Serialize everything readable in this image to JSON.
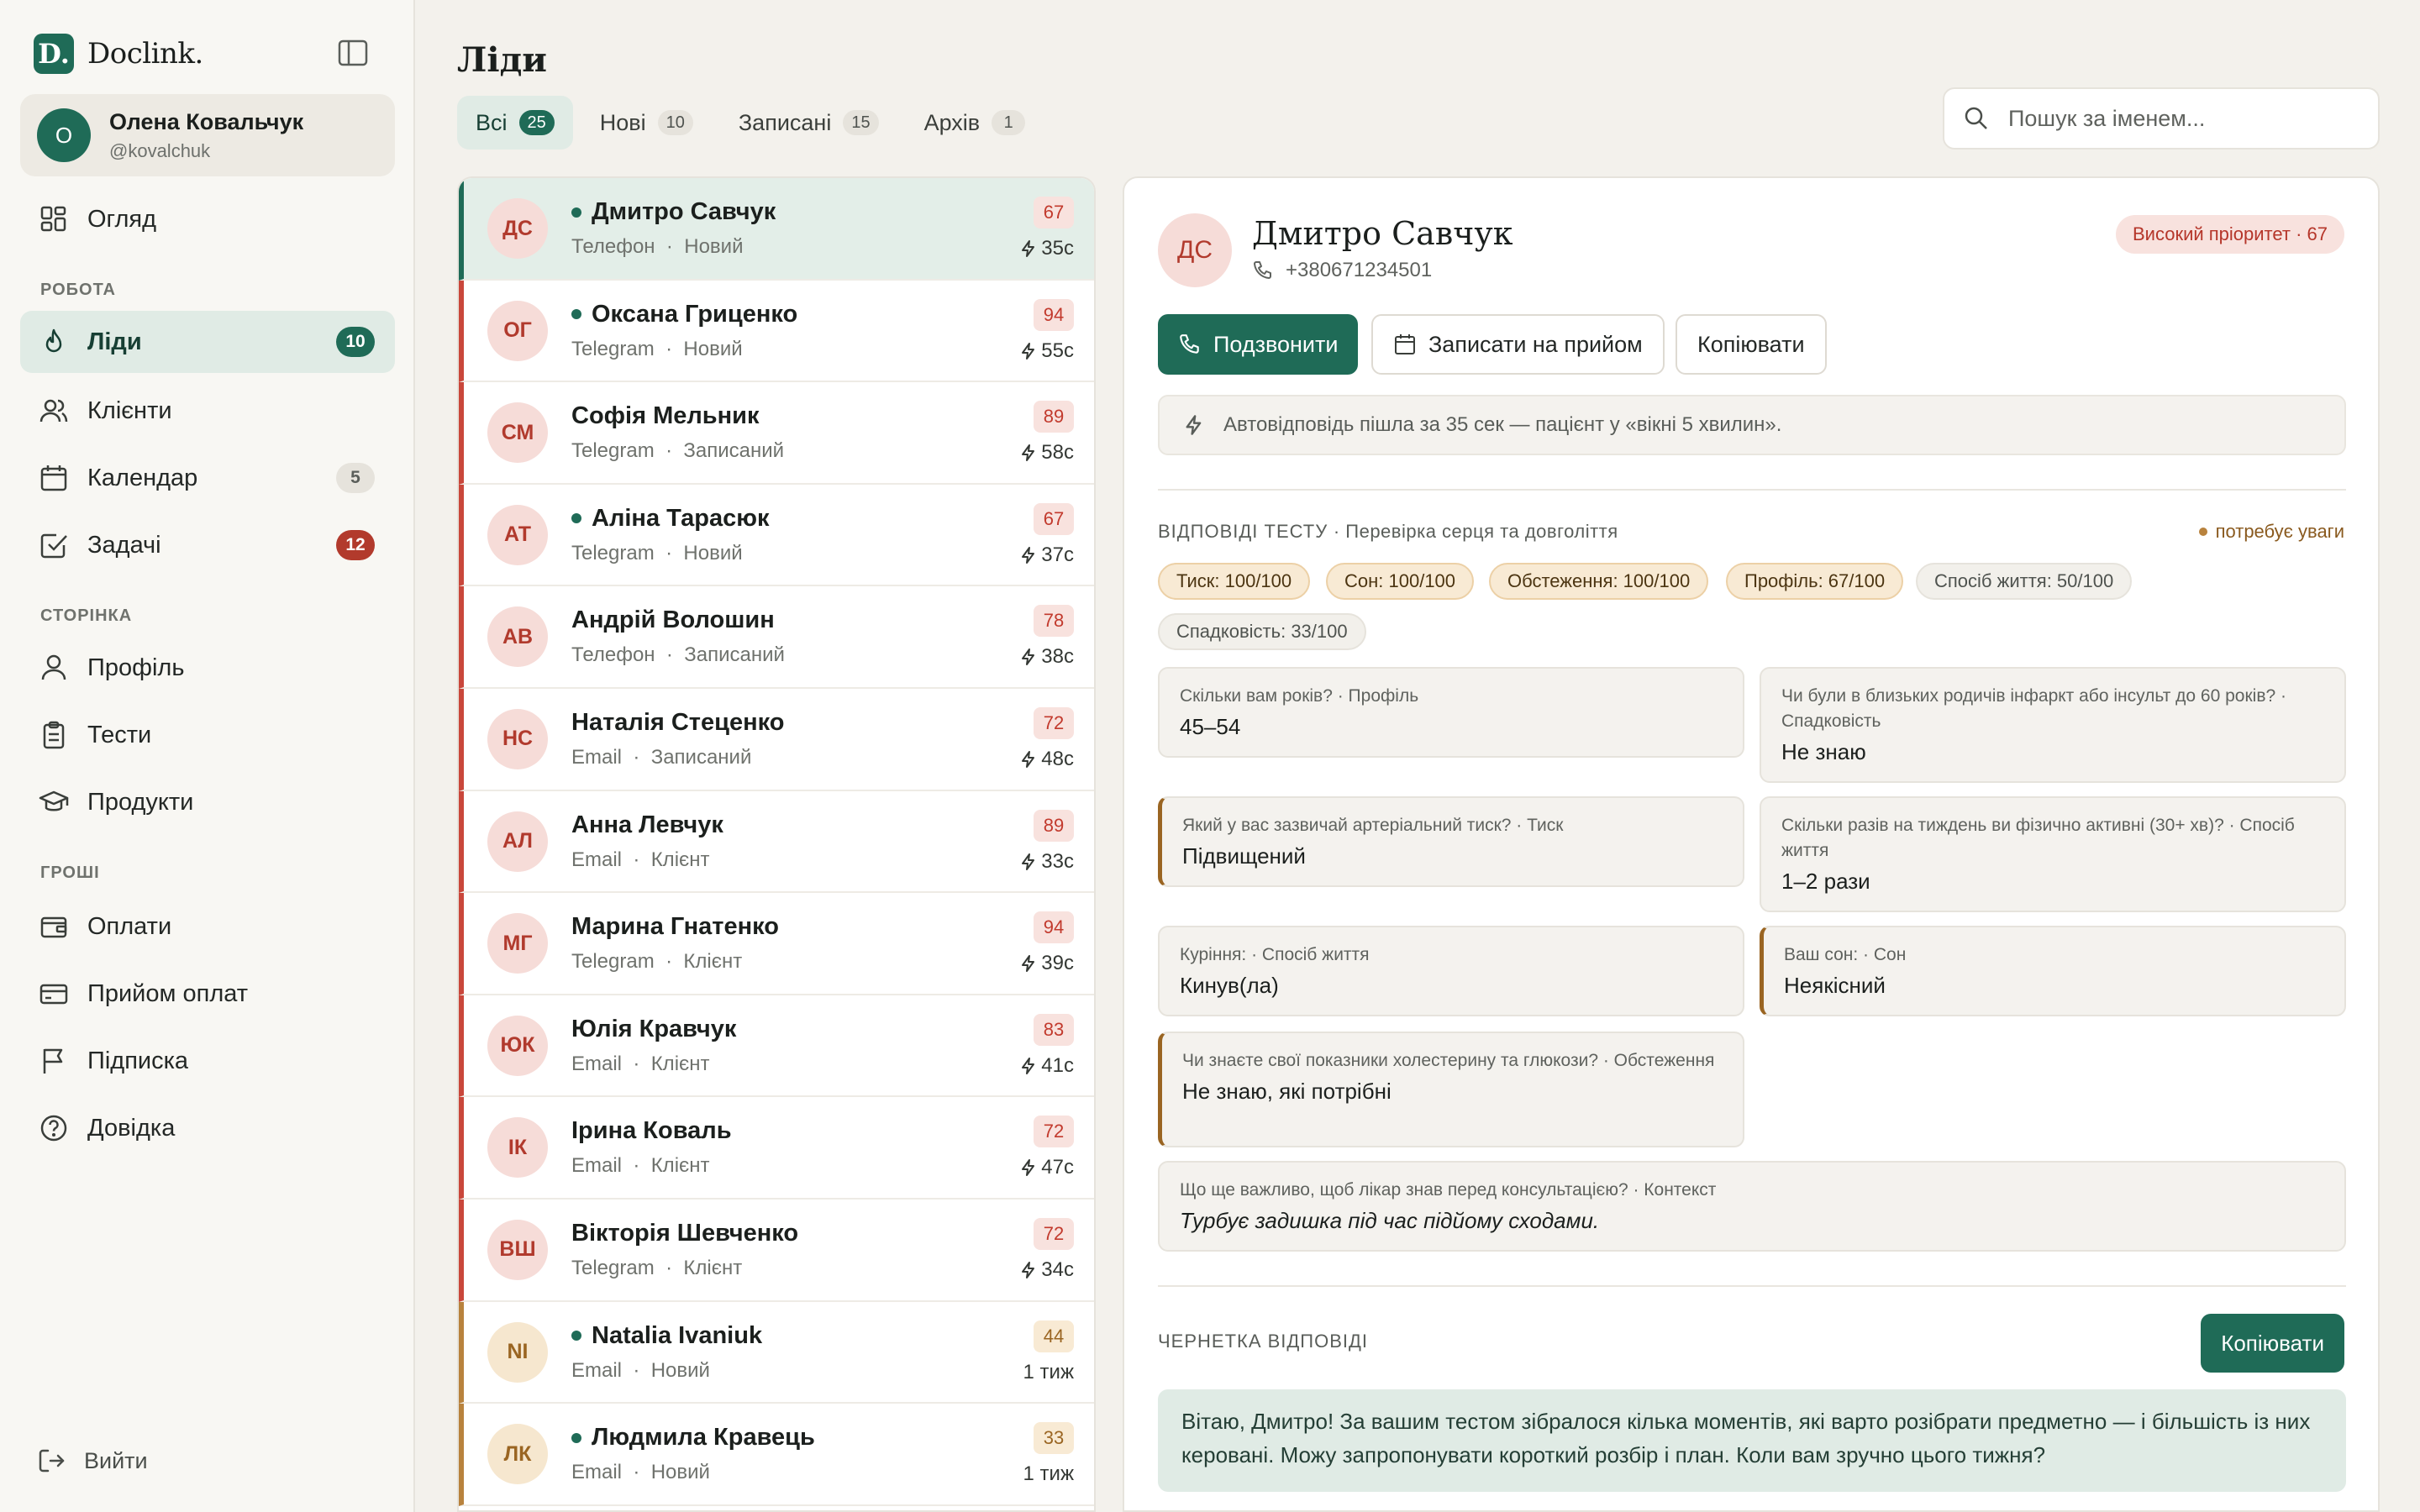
{
  "app": {
    "logo_letter": "D.",
    "name": "Doclink."
  },
  "user": {
    "initial": "О",
    "name": "Олена Ковальчук",
    "handle": "@kovalchuk"
  },
  "nav": {
    "overview": "Огляд",
    "section_work": "РОБОТА",
    "leads": {
      "label": "Ліди",
      "badge": "10"
    },
    "clients": "Клієнти",
    "calendar": {
      "label": "Календар",
      "badge": "5"
    },
    "tasks": {
      "label": "Задачі",
      "badge": "12"
    },
    "section_page": "СТОРІНКА",
    "profile": "Профіль",
    "tests": "Тести",
    "products": "Продукти",
    "section_money": "ГРОШІ",
    "payments": "Оплати",
    "payment_accept": "Прийом оплат",
    "subscription": "Підписка",
    "help": "Довідка",
    "logout": "Вийти"
  },
  "page": {
    "title": "Ліди"
  },
  "tabs": [
    {
      "label": "Всі",
      "count": "25"
    },
    {
      "label": "Нові",
      "count": "10"
    },
    {
      "label": "Записані",
      "count": "15"
    },
    {
      "label": "Архів",
      "count": "1"
    }
  ],
  "search": {
    "placeholder": "Пошук за іменем..."
  },
  "leads": [
    {
      "initials": "ДС",
      "name": "Дмитро Савчук",
      "channel": "Телефон",
      "status": "Новий",
      "score": "67",
      "time": "35с"
    },
    {
      "initials": "ОГ",
      "name": "Оксана Гриценко",
      "channel": "Telegram",
      "status": "Новий",
      "score": "94",
      "time": "55с"
    },
    {
      "initials": "СМ",
      "name": "Софія Мельник",
      "channel": "Telegram",
      "status": "Записаний",
      "score": "89",
      "time": "58с"
    },
    {
      "initials": "АТ",
      "name": "Аліна Тарасюк",
      "channel": "Telegram",
      "status": "Новий",
      "score": "67",
      "time": "37с"
    },
    {
      "initials": "АВ",
      "name": "Андрій Волошин",
      "channel": "Телефон",
      "status": "Записаний",
      "score": "78",
      "time": "38с"
    },
    {
      "initials": "НС",
      "name": "Наталія Стеценко",
      "channel": "Email",
      "status": "Записаний",
      "score": "72",
      "time": "48с"
    },
    {
      "initials": "АЛ",
      "name": "Анна Левчук",
      "channel": "Email",
      "status": "Клієнт",
      "score": "89",
      "time": "33с"
    },
    {
      "initials": "МГ",
      "name": "Марина Гнатенко",
      "channel": "Telegram",
      "status": "Клієнт",
      "score": "94",
      "time": "39с"
    },
    {
      "initials": "ЮК",
      "name": "Юлія Кравчук",
      "channel": "Email",
      "status": "Клієнт",
      "score": "83",
      "time": "41с"
    },
    {
      "initials": "ІК",
      "name": "Ірина Коваль",
      "channel": "Email",
      "status": "Клієнт",
      "score": "72",
      "time": "47с"
    },
    {
      "initials": "ВШ",
      "name": "Вікторія Шевченко",
      "channel": "Telegram",
      "status": "Клієнт",
      "score": "72",
      "time": "34с"
    },
    {
      "initials": "NI",
      "name": "Natalia Ivaniuk",
      "channel": "Email",
      "status": "Новий",
      "score": "44",
      "time": "1 тиж"
    },
    {
      "initials": "ЛК",
      "name": "Людмила Кравець",
      "channel": "Email",
      "status": "Новий",
      "score": "33",
      "time": "1 тиж"
    }
  ],
  "lead_sep": "·",
  "detail": {
    "initials": "ДС",
    "name": "Дмитро Савчук",
    "phone": "+380671234501",
    "priority": "Високий пріоритет · 67",
    "call_button": "Подзвонити",
    "book_button": "Записати на прийом",
    "copy_button": "Копіювати",
    "autoreply_note": "Автовідповідь пішла за 35 сек — пацієнт у «вікні 5 хвилин».",
    "test_label": "ВІДПОВІДІ ТЕСТУ",
    "test_name": " · Перевірка серця та довголіття",
    "attention": "потребує уваги",
    "chips": [
      "Тиск: 100/100",
      "Сон: 100/100",
      "Обстеження: 100/100",
      "Профіль: 67/100",
      "Спосіб життя: 50/100",
      "Спадковість: 33/100"
    ],
    "qa": [
      {
        "q": "Скільки вам років? · Профіль",
        "a": "45–54"
      },
      {
        "q": "Чи були в близьких родичів інфаркт або інсульт до 60 років? · Спадковість",
        "a": "Не знаю"
      },
      {
        "q": "Який у вас зазвичай артеріальний тиск? · Тиск",
        "a": "Підвищений"
      },
      {
        "q": "Скільки разів на тиждень ви фізично активні (30+ хв)? · Спосіб життя",
        "a": "1–2 рази"
      },
      {
        "q": "Куріння: · Спосіб життя",
        "a": "Кинув(ла)"
      },
      {
        "q": "Ваш сон: · Сон",
        "a": "Неякісний"
      },
      {
        "q": "Чи знаєте свої показники холестерину та глюкози? · Обстеження",
        "a": "Не знаю, які потрібні"
      },
      {
        "q": "Що ще важливо, щоб лікар знав перед консультацією? · Контекст",
        "a": "Турбує задишка під час підйому сходами."
      }
    ],
    "draft_label": "ЧЕРНЕТКА ВІДПОВІДІ",
    "draft_copy": "Копіювати",
    "draft_text": "Вітаю, Дмитро! За вашим тестом зібралося кілька моментів, які варто розібрати предметно — і більшість із них керовані. Можу запропонувати короткий розбір і план. Коли вам зручно цього тижня?"
  },
  "colors": {
    "brand": "#1f6b57",
    "danger": "#c9473b",
    "warning": "#b8823d"
  }
}
